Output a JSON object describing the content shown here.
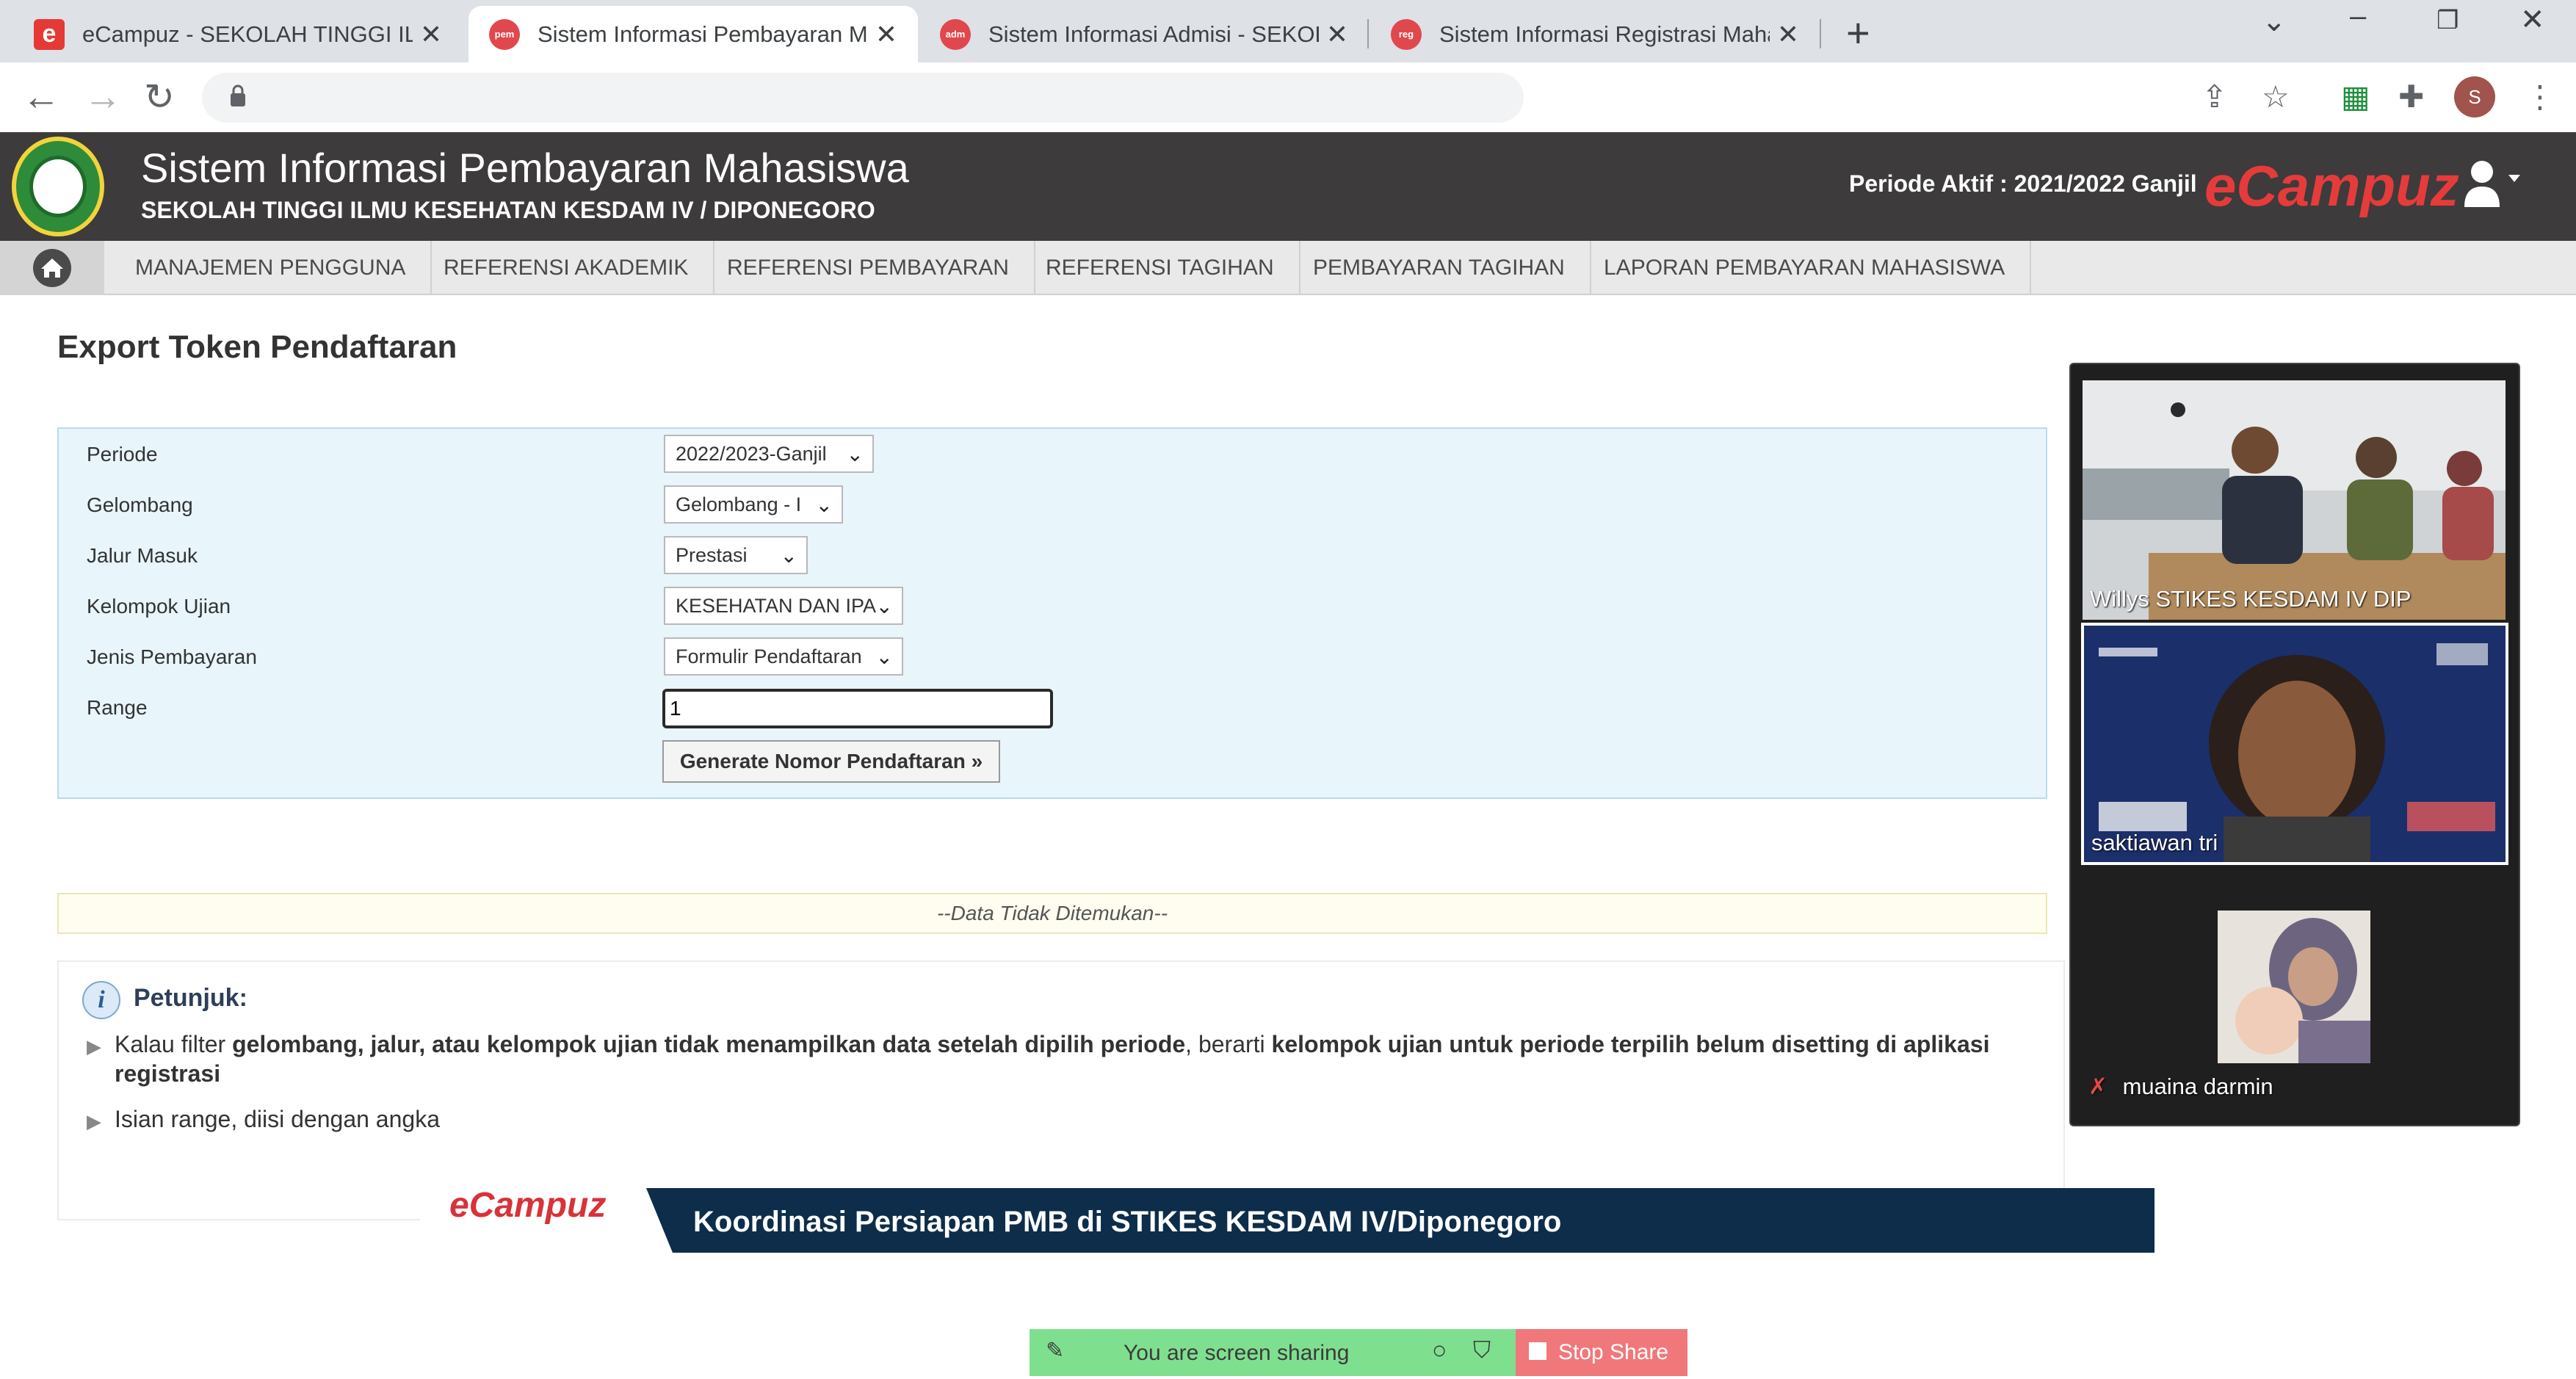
{
  "browser": {
    "tabs": [
      {
        "title": "eCampuz - SEKOLAH TINGGI ILMU",
        "favicon": "e"
      },
      {
        "title": "Sistem Informasi Pembayaran Ma",
        "favicon": "pem"
      },
      {
        "title": "Sistem Informasi Admisi - SEKOL",
        "favicon": "adm"
      },
      {
        "title": "Sistem Informasi Registrasi Maha",
        "favicon": "reg"
      }
    ],
    "profile_initial": "S"
  },
  "header": {
    "title": "Sistem Informasi Pembayaran Mahasiswa",
    "subtitle": "SEKOLAH TINGGI ILMU KESEHATAN KESDAM IV / DIPONEGORO",
    "periode_aktif": "Periode Aktif : 2021/2022 Ganjil",
    "brand": "eCampuz",
    "brand_color": "#e63b3b"
  },
  "nav": {
    "items": [
      "MANAJEMEN PENGGUNA",
      "REFERENSI AKADEMIK",
      "REFERENSI PEMBAYARAN",
      "REFERENSI TAGIHAN",
      "PEMBAYARAN TAGIHAN",
      "LAPORAN PEMBAYARAN MAHASISWA"
    ]
  },
  "page": {
    "title": "Export Token Pendaftaran"
  },
  "form": {
    "fields": [
      {
        "label": "Periode",
        "value": "2022/2023-Ganjil"
      },
      {
        "label": "Gelombang",
        "value": "Gelombang - I"
      },
      {
        "label": "Jalur Masuk",
        "value": "Prestasi"
      },
      {
        "label": "Kelompok Ujian",
        "value": "KESEHATAN DAN IPA"
      },
      {
        "label": "Jenis Pembayaran",
        "value": "Formulir Pendaftaran"
      }
    ],
    "range_label": "Range",
    "range_value": "1",
    "generate_label": "Generate Nomor Pendaftaran »"
  },
  "result": {
    "empty_text": "--Data Tidak Ditemukan--"
  },
  "hints": {
    "title": "Petunjuk:",
    "item1_pre": "Kalau filter ",
    "item1_bold": "gelombang, jalur, atau kelompok ujian tidak menampilkan data setelah dipilih periode",
    "item1_mid": ", berarti ",
    "item1_bold2": "kelompok ujian untuk periode terpilih belum disetting di aplikasi registrasi",
    "item2": "Isian range, diisi dengan angka"
  },
  "video": {
    "participants": [
      {
        "name": "Willys STIKES KESDAM IV DIP"
      },
      {
        "name": "saktiawan tri"
      },
      {
        "name": "muaina darmin"
      }
    ]
  },
  "banner": {
    "logo": "eCampuz",
    "text": "Koordinasi Persiapan PMB di STIKES KESDAM IV/Diponegoro"
  },
  "share": {
    "status": "You are screen sharing",
    "stop": "Stop Share"
  }
}
